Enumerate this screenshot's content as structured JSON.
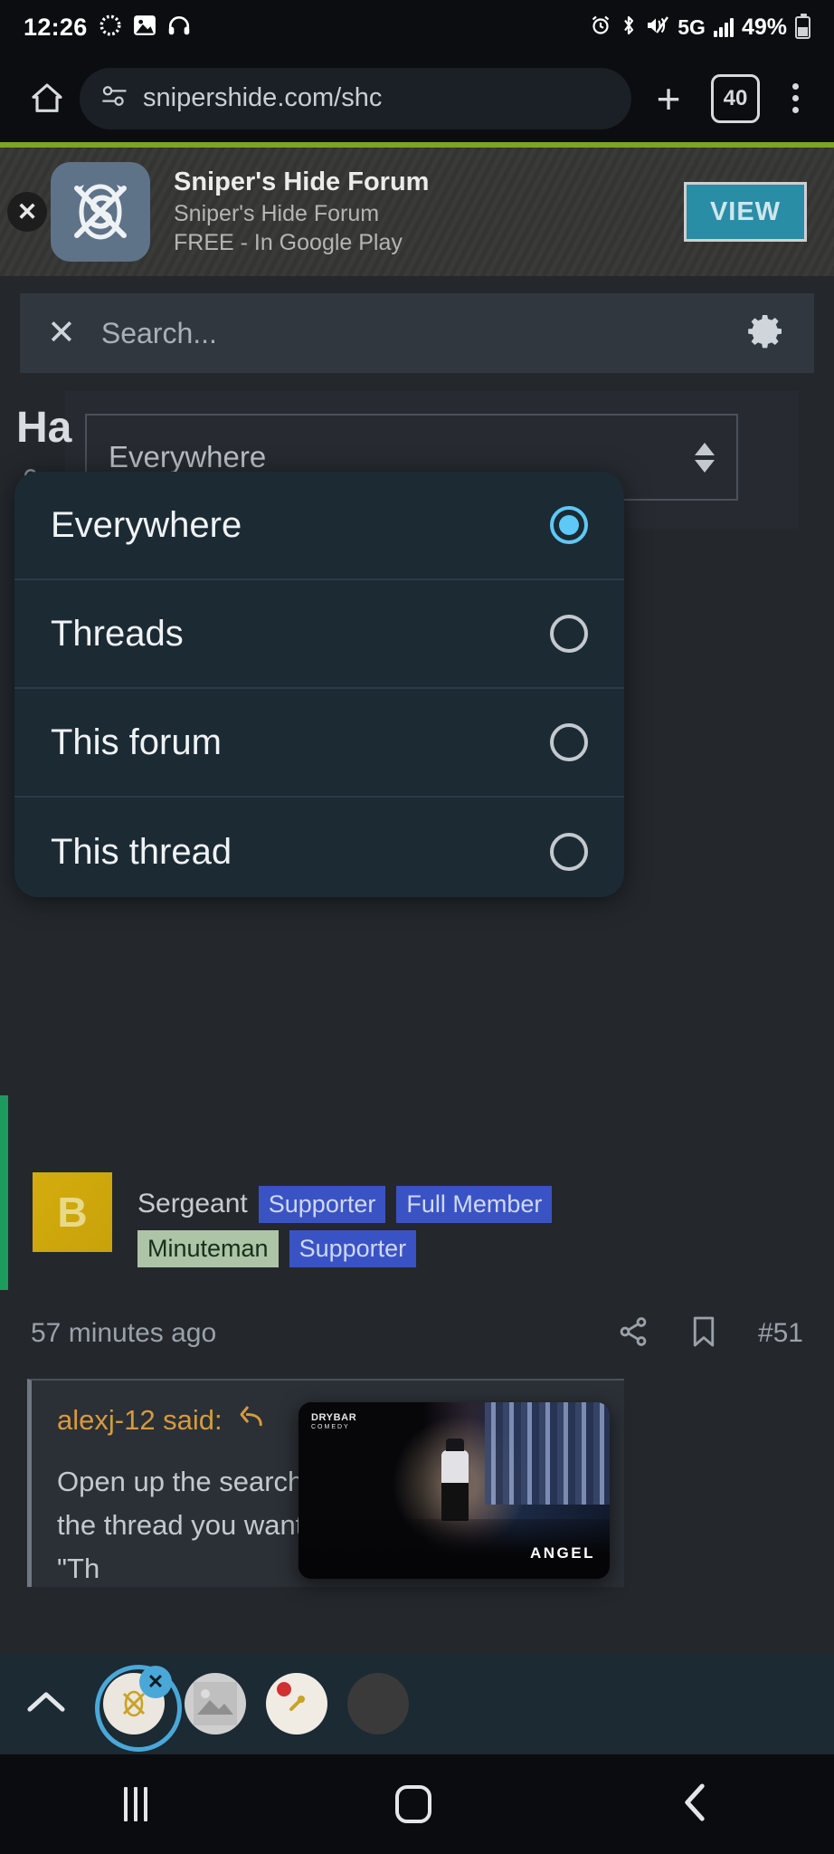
{
  "statusbar": {
    "time": "12:26",
    "icons_left": [
      "dotted-circle-icon",
      "image-icon",
      "headphones-icon"
    ],
    "icons_right": [
      "alarm-icon",
      "bluetooth-icon",
      "mute-icon"
    ],
    "network": "5G",
    "battery_percent": "49%"
  },
  "browser": {
    "home_icon": "home-icon",
    "site_info_icon": "site-settings-icon",
    "url": "snipershide.com/shc",
    "new_tab_label": "+",
    "tab_count": "40",
    "menu_icon": "overflow-menu-icon"
  },
  "ad": {
    "close_label": "✕",
    "app_icon": "snipers-hide-app-icon",
    "title": "Sniper's Hide Forum",
    "subtitle": "Sniper's Hide Forum",
    "price": "FREE - In Google Play",
    "cta_label": "VIEW",
    "accent_top": "#7ba428",
    "cta_bg": "#2a8da6"
  },
  "search": {
    "close_icon": "close-icon",
    "placeholder": "Search...",
    "value": "",
    "settings_icon": "gear-icon"
  },
  "filter_select": {
    "selected": "Everywhere",
    "stepper_icon": "updown-arrows-icon"
  },
  "page_behind": {
    "heading": "Ha",
    "member_icon": "person-icon"
  },
  "dropdown": {
    "options": [
      {
        "label": "Everywhere",
        "selected": true
      },
      {
        "label": "Threads",
        "selected": false
      },
      {
        "label": "This forum",
        "selected": false
      },
      {
        "label": "This thread",
        "selected": false
      }
    ],
    "selected_color": "#5ec8f7"
  },
  "post": {
    "avatar_initial": "B",
    "rank": "Sergeant",
    "badges": [
      {
        "label": "Supporter",
        "style": "blue"
      },
      {
        "label": "Full Member",
        "style": "blue"
      },
      {
        "label": "Minuteman",
        "style": "green"
      },
      {
        "label": "Supporter",
        "style": "blue"
      }
    ],
    "timestamp": "57 minutes ago",
    "share_icon": "share-icon",
    "bookmark_icon": "bookmark-icon",
    "post_number": "#51",
    "quote": {
      "author_line": "alexj-12 said:",
      "reply_icon": "reply-arrow-icon",
      "body": "Open up the search dropdown and select the thread you want to search and select \"Th"
    }
  },
  "pip": {
    "channel_logo": "DRYBAR",
    "channel_sub": "COMEDY",
    "watermark": "ANGEL"
  },
  "tabstrip": {
    "collapse_icon": "chevron-up-icon",
    "tabs": [
      {
        "name": "snipers-hide-tab",
        "selected": true,
        "close_label": "✕"
      },
      {
        "name": "photo-tab",
        "selected": false
      },
      {
        "name": "notification-tab",
        "selected": false
      },
      {
        "name": "extra-tab",
        "selected": false
      }
    ]
  },
  "android_nav": {
    "recents_icon": "recents-icon",
    "home_icon": "home-square-icon",
    "back_icon": "back-chevron-icon"
  }
}
